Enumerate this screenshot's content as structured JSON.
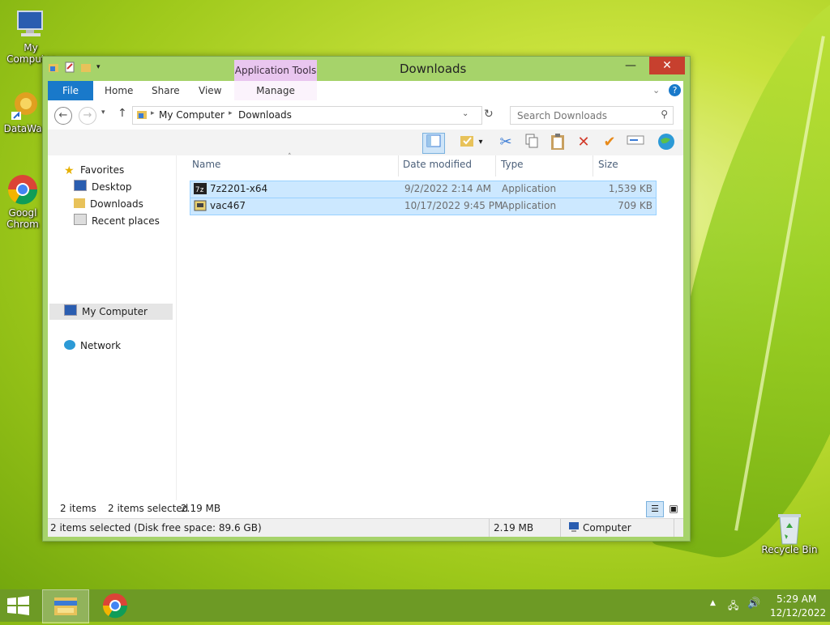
{
  "desktop": {
    "icons": [
      {
        "label": "My Computer"
      },
      {
        "label": "DataWag"
      },
      {
        "label": "Googl Chrom"
      },
      {
        "label": "Recycle Bin"
      }
    ]
  },
  "window": {
    "title": "Downloads",
    "context_tab_header": "Application Tools",
    "ribbon_tabs": {
      "file": "File",
      "home": "Home",
      "share": "Share",
      "view": "View",
      "manage": "Manage"
    },
    "address": {
      "segments": [
        "My Computer",
        "Downloads"
      ]
    },
    "search": {
      "placeholder": "Search Downloads"
    },
    "nav": {
      "favorites": "Favorites",
      "desktop": "Desktop",
      "downloads": "Downloads",
      "recent": "Recent places",
      "my_computer": "My Computer",
      "network": "Network"
    },
    "columns": {
      "name": "Name",
      "date": "Date modified",
      "type": "Type",
      "size": "Size"
    },
    "files": [
      {
        "name": "7z2201-x64",
        "date": "9/2/2022 2:14 AM",
        "type": "Application",
        "size": "1,539 KB"
      },
      {
        "name": "vac467",
        "date": "10/17/2022 9:45 PM",
        "type": "Application",
        "size": "709 KB"
      }
    ],
    "status": {
      "items": "2 items",
      "selected": "2 items selected",
      "selected_size": "2.19 MB"
    },
    "statusbar": {
      "left": "2 items selected (Disk free space: 89.6 GB)",
      "size": "2.19 MB",
      "location": "Computer"
    }
  },
  "taskbar": {
    "time": "5:29 AM",
    "date": "12/12/2022"
  },
  "colors": {
    "accent": "#1979ca",
    "window_frame": "#a6d36a",
    "selection": "#cce8ff",
    "taskbar": "#6d9a25"
  }
}
